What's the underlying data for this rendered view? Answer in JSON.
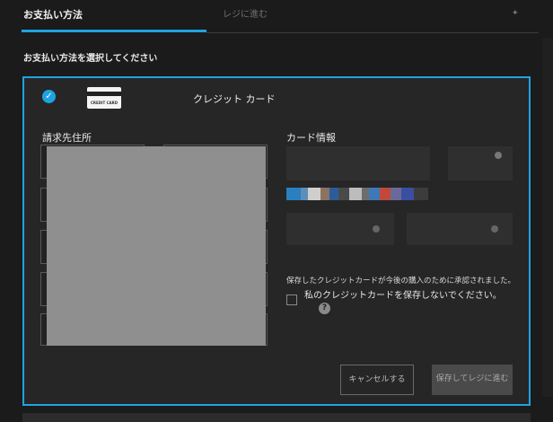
{
  "tabs": {
    "active_label": "お支払い方法",
    "next_label": "レジに進む"
  },
  "section_title": "お支払い方法を選択してください",
  "payment_method": {
    "selected": true,
    "card_icon_text": "CREDIT CARD",
    "label": "クレジット カード"
  },
  "billing": {
    "label": "請求先住所"
  },
  "card_info": {
    "label": "カード情報"
  },
  "saved_card_note": "保存したクレジットカードが今後の購入のために承認されました。",
  "dont_save_checkbox": {
    "checked": false,
    "label": "私のクレジットカードを保存しないでください。",
    "help_icon": "?"
  },
  "buttons": {
    "cancel": "キャンセルする",
    "save_and_continue": "保存してレジに進む"
  },
  "colors": {
    "accent": "#1fa3e0",
    "background": "#1b1b1b",
    "panel": "#262626"
  }
}
